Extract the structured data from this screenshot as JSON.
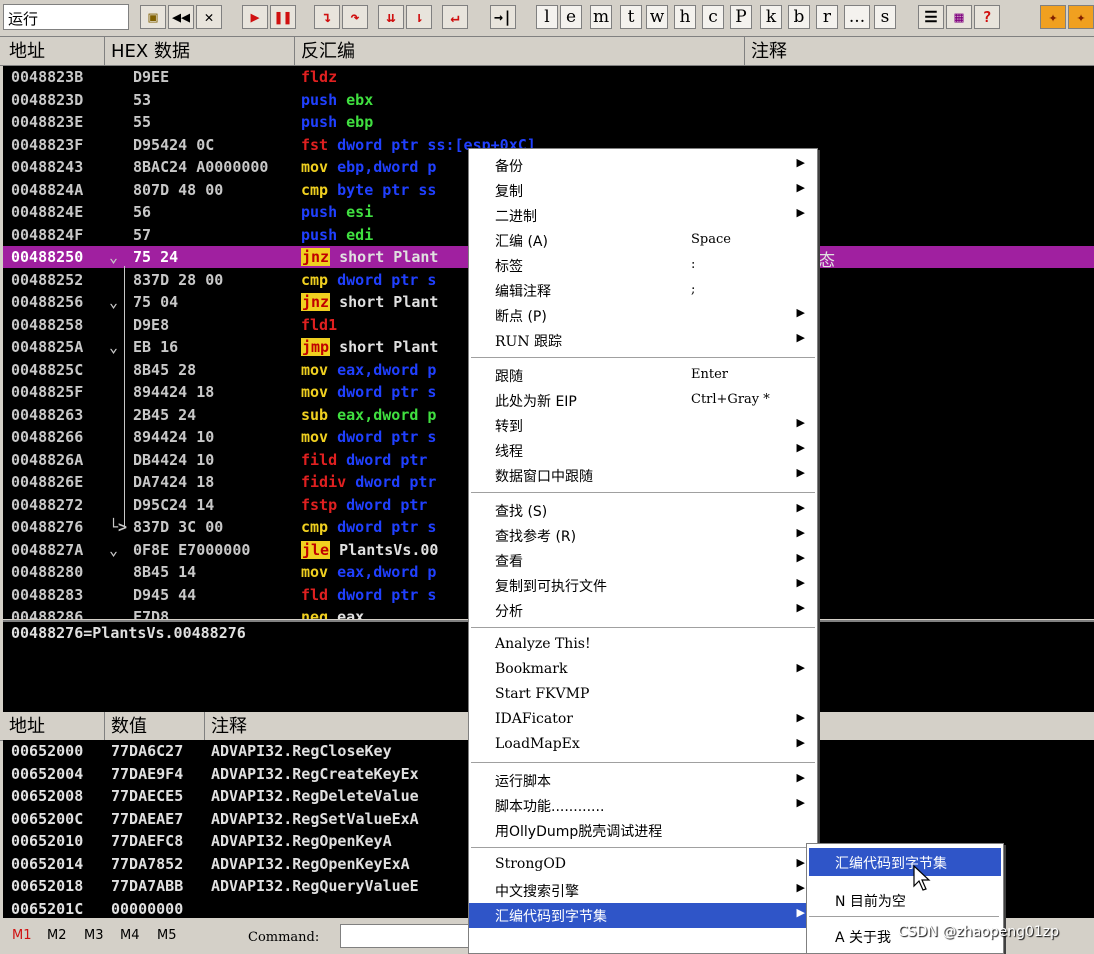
{
  "toolbar": {
    "status": "运行",
    "letters": [
      "l",
      "e",
      "m",
      "t",
      "w",
      "h",
      "c",
      "P",
      "k",
      "b",
      "r",
      "...",
      "s"
    ],
    "help": "?"
  },
  "disasm_header": {
    "addr": "地址",
    "hex": "HEX 数据",
    "disasm": "反汇编",
    "comment": "注释"
  },
  "disasm_rows": [
    {
      "addr": "0048823B",
      "hex": "D9EE",
      "mn": "fldz",
      "ops": "",
      "jmp": ""
    },
    {
      "addr": "0048823D",
      "hex": "53",
      "mn": "push",
      "ops": "ebx",
      "jmp": ""
    },
    {
      "addr": "0048823E",
      "hex": "55",
      "mn": "push",
      "ops": "ebp",
      "jmp": ""
    },
    {
      "addr": "0048823F",
      "hex": "D95424 0C",
      "mn": "fst",
      "ops": "dword ptr ss:[esp+0xC]",
      "jmp": ""
    },
    {
      "addr": "00488243",
      "hex": "8BAC24 A0000000",
      "mn": "mov",
      "ops": "ebp,dword p",
      "jmp": ""
    },
    {
      "addr": "0048824A",
      "hex": "807D 48 00",
      "mn": "cmp",
      "ops": "byte ptr ss",
      "jmp": ""
    },
    {
      "addr": "0048824E",
      "hex": "56",
      "mn": "push",
      "ops": "esi",
      "jmp": ""
    },
    {
      "addr": "0048824F",
      "hex": "57",
      "mn": "push",
      "ops": "edi",
      "jmp": ""
    },
    {
      "addr": "00488250",
      "hex": "75 24",
      "mn": "jnz",
      "ops": "short Plant",
      "jmp": "⌄"
    },
    {
      "addr": "00488252",
      "hex": "837D 28 00",
      "mn": "cmp",
      "ops": "dword ptr s",
      "jmp": ""
    },
    {
      "addr": "00488256",
      "hex": "75 04",
      "mn": "jnz",
      "ops": "short Plant",
      "jmp": "⌄"
    },
    {
      "addr": "00488258",
      "hex": "D9E8",
      "mn": "fld1",
      "ops": "",
      "jmp": ""
    },
    {
      "addr": "0048825A",
      "hex": "EB 16",
      "mn": "jmp",
      "ops": "short Plant",
      "jmp": "⌄"
    },
    {
      "addr": "0048825C",
      "hex": "8B45 28",
      "mn": "mov",
      "ops": "eax,dword p",
      "jmp": ""
    },
    {
      "addr": "0048825F",
      "hex": "894424 18",
      "mn": "mov",
      "ops": "dword ptr s",
      "jmp": ""
    },
    {
      "addr": "00488263",
      "hex": "2B45 24",
      "mn": "sub",
      "ops": "eax,dword p",
      "jmp": ""
    },
    {
      "addr": "00488266",
      "hex": "894424 10",
      "mn": "mov",
      "ops": "dword ptr s",
      "jmp": ""
    },
    {
      "addr": "0048826A",
      "hex": "DB4424 10",
      "mn": "fild",
      "ops": "dword ptr",
      "jmp": ""
    },
    {
      "addr": "0048826E",
      "hex": "DA7424 18",
      "mn": "fidiv",
      "ops": "dword ptr",
      "jmp": ""
    },
    {
      "addr": "00488272",
      "hex": "D95C24 14",
      "mn": "fstp",
      "ops": "dword ptr",
      "jmp": ""
    },
    {
      "addr": "00488276",
      "hex": "837D 3C 00",
      "mn": "cmp",
      "ops": "dword ptr s",
      "jmp": "└>"
    },
    {
      "addr": "0048827A",
      "hex": "0F8E E7000000",
      "mn": "jle",
      "ops": "PlantsVs.00",
      "jmp": "⌄"
    },
    {
      "addr": "00488280",
      "hex": "8B45 14",
      "mn": "mov",
      "ops": "eax,dword p",
      "jmp": ""
    },
    {
      "addr": "00488283",
      "hex": "D945 44",
      "mn": "fld",
      "ops": "dword ptr s",
      "jmp": ""
    },
    {
      "addr": "00488286",
      "hex": "F7D8",
      "mn": "neg",
      "ops": "eax",
      "jmp": ""
    }
  ],
  "selected_comment": "态",
  "info_line": "00488276=PlantsVs.00488276",
  "dump_header": {
    "addr": "地址",
    "value": "数值",
    "comment": "注释"
  },
  "dump_rows": [
    {
      "addr": "00652000",
      "val": "77DA6C27",
      "cmt": "ADVAPI32.RegCloseKey"
    },
    {
      "addr": "00652004",
      "val": "77DAE9F4",
      "cmt": "ADVAPI32.RegCreateKeyEx"
    },
    {
      "addr": "00652008",
      "val": "77DAECE5",
      "cmt": "ADVAPI32.RegDeleteValue"
    },
    {
      "addr": "0065200C",
      "val": "77DAEAE7",
      "cmt": "ADVAPI32.RegSetValueExA"
    },
    {
      "addr": "00652010",
      "val": "77DAEFC8",
      "cmt": "ADVAPI32.RegOpenKeyA"
    },
    {
      "addr": "00652014",
      "val": "77DA7852",
      "cmt": "ADVAPI32.RegOpenKeyExA"
    },
    {
      "addr": "00652018",
      "val": "77DA7ABB",
      "cmt": "ADVAPI32.RegQueryValueE"
    },
    {
      "addr": "0065201C",
      "val": "00000000",
      "cmt": ""
    }
  ],
  "cmdbar": {
    "tabs": [
      "M1",
      "M2",
      "M3",
      "M4",
      "M5"
    ],
    "label": "Command:"
  },
  "menu": {
    "groups": [
      [
        {
          "label": "备份",
          "shortcut": "",
          "sub": true
        },
        {
          "label": "复制",
          "shortcut": "",
          "sub": true
        },
        {
          "label": "二进制",
          "shortcut": "",
          "sub": true
        },
        {
          "label": "汇编 (A)",
          "shortcut": "Space",
          "sub": false
        },
        {
          "label": "标签",
          "shortcut": ":",
          "sub": false
        },
        {
          "label": "编辑注释",
          "shortcut": ";",
          "sub": false
        },
        {
          "label": "断点 (P)",
          "shortcut": "",
          "sub": true
        },
        {
          "label": "RUN 跟踪",
          "shortcut": "",
          "sub": true
        }
      ],
      [
        {
          "label": "跟随",
          "shortcut": "Enter",
          "sub": false
        },
        {
          "label": "此处为新 EIP",
          "shortcut": "Ctrl+Gray *",
          "sub": false
        },
        {
          "label": "转到",
          "shortcut": "",
          "sub": true
        },
        {
          "label": "线程",
          "shortcut": "",
          "sub": true
        },
        {
          "label": "数据窗口中跟随",
          "shortcut": "",
          "sub": true
        }
      ],
      [
        {
          "label": "查找 (S)",
          "shortcut": "",
          "sub": true
        },
        {
          "label": "查找参考 (R)",
          "shortcut": "",
          "sub": true
        },
        {
          "label": "查看",
          "shortcut": "",
          "sub": true
        },
        {
          "label": "复制到可执行文件",
          "shortcut": "",
          "sub": true
        },
        {
          "label": "分析",
          "shortcut": "",
          "sub": true
        }
      ],
      [
        {
          "label": "Analyze This!",
          "shortcut": "",
          "sub": false
        },
        {
          "label": "Bookmark",
          "shortcut": "",
          "sub": true
        },
        {
          "label": "Start FKVMP",
          "shortcut": "",
          "sub": false
        },
        {
          "label": "IDAFicator",
          "shortcut": "",
          "sub": true
        },
        {
          "label": "LoadMapEx",
          "shortcut": "",
          "sub": true
        }
      ],
      [
        {
          "label": "运行脚本",
          "shortcut": "",
          "sub": true
        },
        {
          "label": "脚本功能............",
          "shortcut": "",
          "sub": true
        },
        {
          "label": "用OllyDump脱壳调试进程",
          "shortcut": "",
          "sub": false
        }
      ],
      [
        {
          "label": "StrongOD",
          "shortcut": "",
          "sub": true
        },
        {
          "label": "中文搜索引擎",
          "shortcut": "",
          "sub": true
        },
        {
          "label": "汇编代码到字节集",
          "shortcut": "",
          "sub": true
        }
      ]
    ]
  },
  "submenu": [
    {
      "label": "汇编代码到字节集"
    },
    {
      "label": "N 目前为空"
    },
    {
      "label": "A 关于我"
    }
  ],
  "watermark": "CSDN @zhaopeng01zp"
}
